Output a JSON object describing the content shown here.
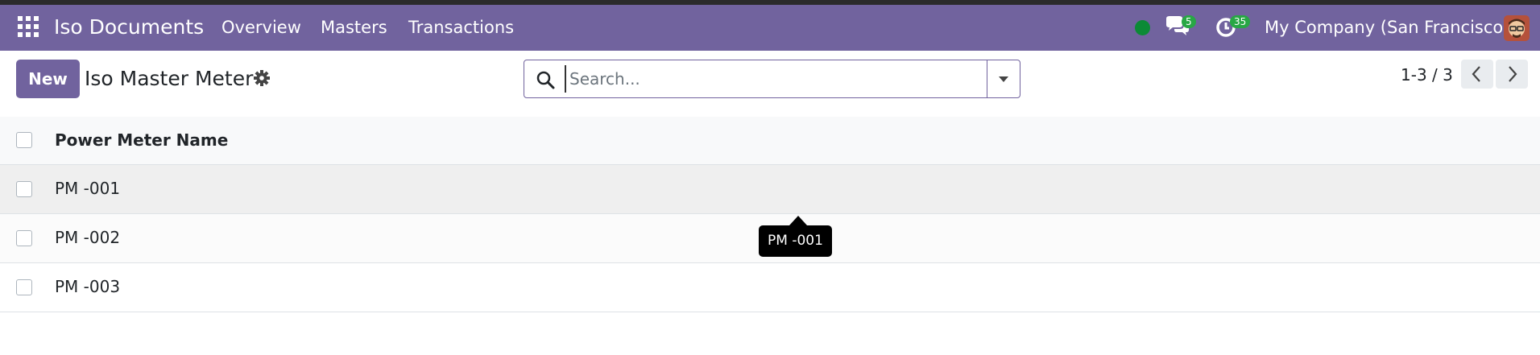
{
  "navbar": {
    "app_name": "Iso Documents",
    "menu": [
      "Overview",
      "Masters",
      "Transactions"
    ],
    "chat_badge": "5",
    "activity_badge": "35",
    "company": "My Company (San Francisco)",
    "colors": {
      "bar": "#71639e",
      "status": "#0c8a36",
      "badge": "#28a745"
    },
    "icons": [
      "apps-grid-icon",
      "presence-status-icon",
      "chat-bubbles-icon",
      "activity-clock-icon",
      "user-avatar-icon"
    ]
  },
  "control_panel": {
    "new_button": "New",
    "title": "Iso Master Meter",
    "search_placeholder": "Search...",
    "pager": "1-3 / 3",
    "icons": [
      "gear-icon",
      "search-icon",
      "caret-down-icon",
      "chevron-left-icon",
      "chevron-right-icon"
    ]
  },
  "list": {
    "header": "Power Meter Name",
    "rows": [
      "PM -001",
      "PM -002",
      "PM -003"
    ]
  },
  "tooltip": "PM -001"
}
